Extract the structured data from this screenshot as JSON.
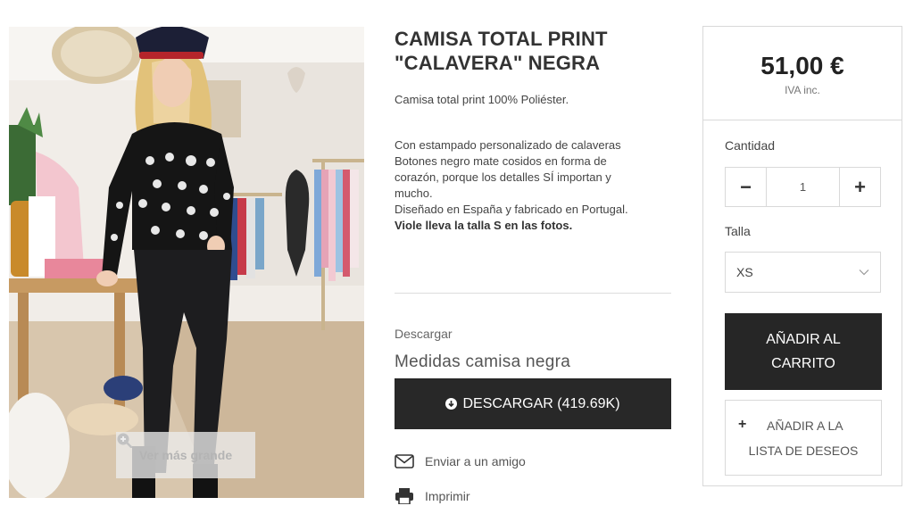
{
  "product": {
    "title_line1": "CAMISA TOTAL PRINT",
    "title_line2": "\"CALAVERA\" NEGRA",
    "subtitle": "Camisa total print  100% Poliéster.",
    "description": [
      "Con estampado personalizado de calaveras",
      "Botones negro mate cosidos en forma de",
      "corazón, porque los detalles SÍ importan y",
      "mucho.",
      "Diseñado en España y fabricado en Portugal."
    ],
    "description_bold": "Viole lleva la talla S en las fotos."
  },
  "gallery": {
    "zoom_label": "Ver más grande",
    "zoom_icon": "zoom-plus-icon"
  },
  "download": {
    "label": "Descargar",
    "file_name": "Medidas camisa negra",
    "button_label": "DESCARGAR (419.69K)",
    "button_icon": "download-circle-icon"
  },
  "share": {
    "email_label": "Enviar a un amigo",
    "email_icon": "envelope-icon",
    "print_label": "Imprimir",
    "print_icon": "printer-icon"
  },
  "purchase": {
    "price": "51,00 €",
    "tax_note": "IVA inc.",
    "quantity_label": "Cantidad",
    "quantity_value": "1",
    "decrement": "−",
    "increment": "+",
    "size_label": "Talla",
    "size_selected": "XS",
    "add_to_cart_line1": "AÑADIR AL",
    "add_to_cart_line2": "CARRITO",
    "wishlist_plus": "+",
    "wishlist_line1": "AÑADIR A LA",
    "wishlist_line2": "LISTA DE DESEOS"
  },
  "colors": {
    "button_dark": "#262626",
    "border": "#d9d9d9",
    "text": "#333333"
  }
}
